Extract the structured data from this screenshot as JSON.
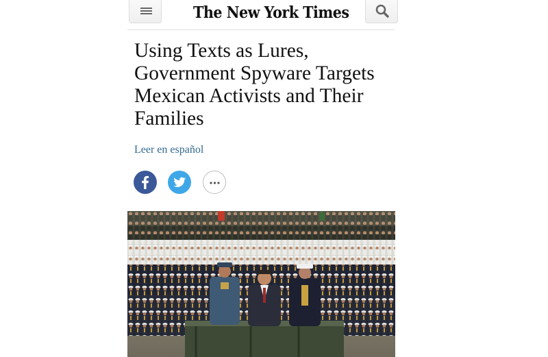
{
  "header": {
    "logo_text": "The New York Times",
    "menu_icon": "hamburger-menu-icon",
    "search_icon": "search-icon"
  },
  "article": {
    "headline": "Using Texts as Lures, Government Spyware Targets Mexican Activists and Their Families",
    "language_link": "Leer en español"
  },
  "share": {
    "facebook_icon": "facebook-icon",
    "twitter_icon": "twitter-icon",
    "more_icon": "more-icon"
  },
  "photo": {
    "subject": "military-parade-photo"
  },
  "colors": {
    "link": "#326891",
    "facebook": "#3b5998",
    "twitter": "#3fa7e8",
    "text": "#111111"
  }
}
